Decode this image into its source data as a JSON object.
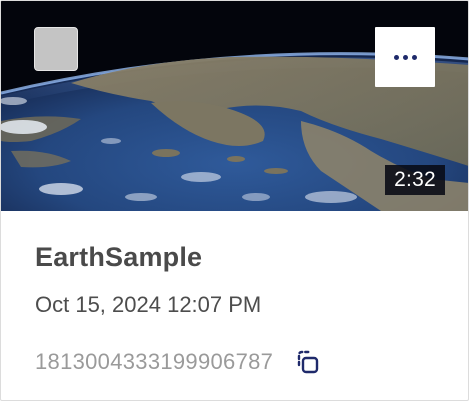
{
  "card": {
    "duration": "2:32",
    "title": "EarthSample",
    "date": "Oct 15, 2024 12:07 PM",
    "asset_id": "1813004333199906787"
  },
  "icons": {
    "menu": "more-horizontal-icon",
    "copy": "copy-icon",
    "checkbox": "checkbox-unchecked"
  },
  "colors": {
    "accent": "#1f2a6b",
    "title": "#4a4a4a",
    "meta": "#9a9a9a"
  }
}
